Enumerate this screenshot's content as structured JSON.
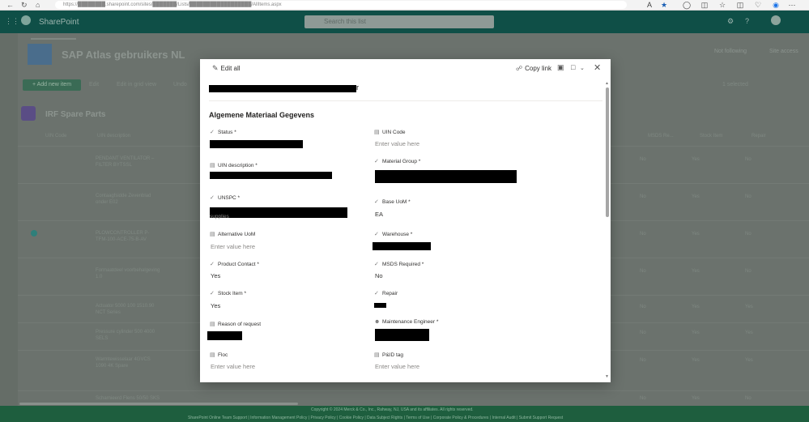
{
  "browser": {
    "back_icon": "back-arrow-icon",
    "refresh_icon": "refresh-icon",
    "home_icon": "home-icon",
    "url": "https://████████.sharepoint.com/sites/███████/Lists/██████████████████/AllItems.aspx"
  },
  "sharepoint": {
    "suite_title": "SharePoint",
    "search_placeholder": "Search this list",
    "site_title": "SAP Atlas gebruikers NL",
    "follow_label": "Not following",
    "share_label": "Site access",
    "new_item_label": "+ Add new item",
    "commands": [
      "Edit",
      "Edit in grid view",
      "Undo"
    ],
    "selected_label": "1 selected",
    "list_title": "IRF Spare Parts",
    "column_headers": [
      "UIN Code",
      "UIN description",
      "MSDS Re...",
      "Stock Item",
      "Repair"
    ],
    "rows": [
      {
        "desc": "PENDANT VENTILATOR – FILTER BYTSSL",
        "msds": "No",
        "stock": "Yes",
        "repair": "No"
      },
      {
        "desc": "Contaagfsidde Zevenblad onder E02",
        "msds": "No",
        "stock": "Yes",
        "repair": "No"
      },
      {
        "desc": "PLOWCONTROLLER P-TFM-100-ACE-75-B-AV",
        "msds": "No",
        "stock": "Yes",
        "repair": "No"
      },
      {
        "desc": "Formaatdeel voorbehalgeving 1.0",
        "msds": "No",
        "stock": "Yes",
        "repair": "No"
      },
      {
        "desc": "Actuator 5000 100 1510.90 NCT Series",
        "msds": "No",
        "stock": "Yes",
        "repair": "Yes"
      },
      {
        "desc": "Pressure cylinder 500 4000 SELS",
        "msds": "No",
        "stock": "Yes",
        "repair": "Yes"
      },
      {
        "desc": "Warmtewisselaar 4GVCS 1090 4K Spare",
        "msds": "No",
        "stock": "Yes",
        "repair": "Yes"
      },
      {
        "desc": "Scharnieerd Flens 50/50 SKS",
        "msds": "No",
        "stock": "Yes",
        "repair": "No"
      }
    ],
    "footer_line1": "Copyright © 2024 Merck & Co., Inc., Rahway, NJ, USA and its affiliates. All rights reserved.",
    "footer_line2": "SharePoint Online Team Support | Information Management Policy | Privacy Policy | Cookie Policy | Data Subject Rights | Terms of Use | Corporate Policy & Procedures | Internal Audit | Submit Support Request"
  },
  "modal": {
    "edit_all_label": "Edit all",
    "copy_link_label": "Copy link",
    "comment_icon": "comment-icon",
    "share_icon": "share-icon",
    "chevron_icon": "chevron-down-icon",
    "close_icon": "close-icon",
    "title_suffix": "r",
    "section_title": "Algemene Materiaal Gegevens",
    "fields": {
      "status": {
        "label": "Status *",
        "icon": "status-icon"
      },
      "uin_code": {
        "label": "UIN Code",
        "icon": "text-field-icon",
        "placeholder": "Enter value here"
      },
      "uin_description": {
        "label": "UIN description *",
        "icon": "text-field-icon"
      },
      "material_group": {
        "label": "Material Group *",
        "icon": "choice-icon"
      },
      "unspc": {
        "label": "UNSPC *",
        "icon": "choice-icon",
        "sub": "supplies"
      },
      "base_uom": {
        "label": "Base UoM *",
        "icon": "choice-icon",
        "value": "EA"
      },
      "alternative_uom": {
        "label": "Alternative UoM",
        "icon": "text-field-icon",
        "placeholder": "Enter value here"
      },
      "warehouse": {
        "label": "Warehouse *",
        "icon": "choice-icon"
      },
      "product_contact": {
        "label": "Product Contact *",
        "icon": "choice-icon",
        "value": "Yes"
      },
      "msds_required": {
        "label": "MSDS Required *",
        "icon": "choice-icon",
        "value": "No"
      },
      "stock_item": {
        "label": "Stock Item *",
        "icon": "choice-icon",
        "value": "Yes"
      },
      "repair": {
        "label": "Repair",
        "icon": "choice-icon"
      },
      "reason_of_request": {
        "label": "Reason of request",
        "icon": "text-field-icon"
      },
      "maintenance_engineer": {
        "label": "Maintenance Engineer *",
        "icon": "person-icon"
      },
      "floc": {
        "label": "Floc",
        "icon": "text-field-icon",
        "placeholder": "Enter value here"
      },
      "pid_tag": {
        "label": "P&ID tag",
        "icon": "text-field-icon",
        "placeholder": "Enter value here"
      }
    }
  }
}
